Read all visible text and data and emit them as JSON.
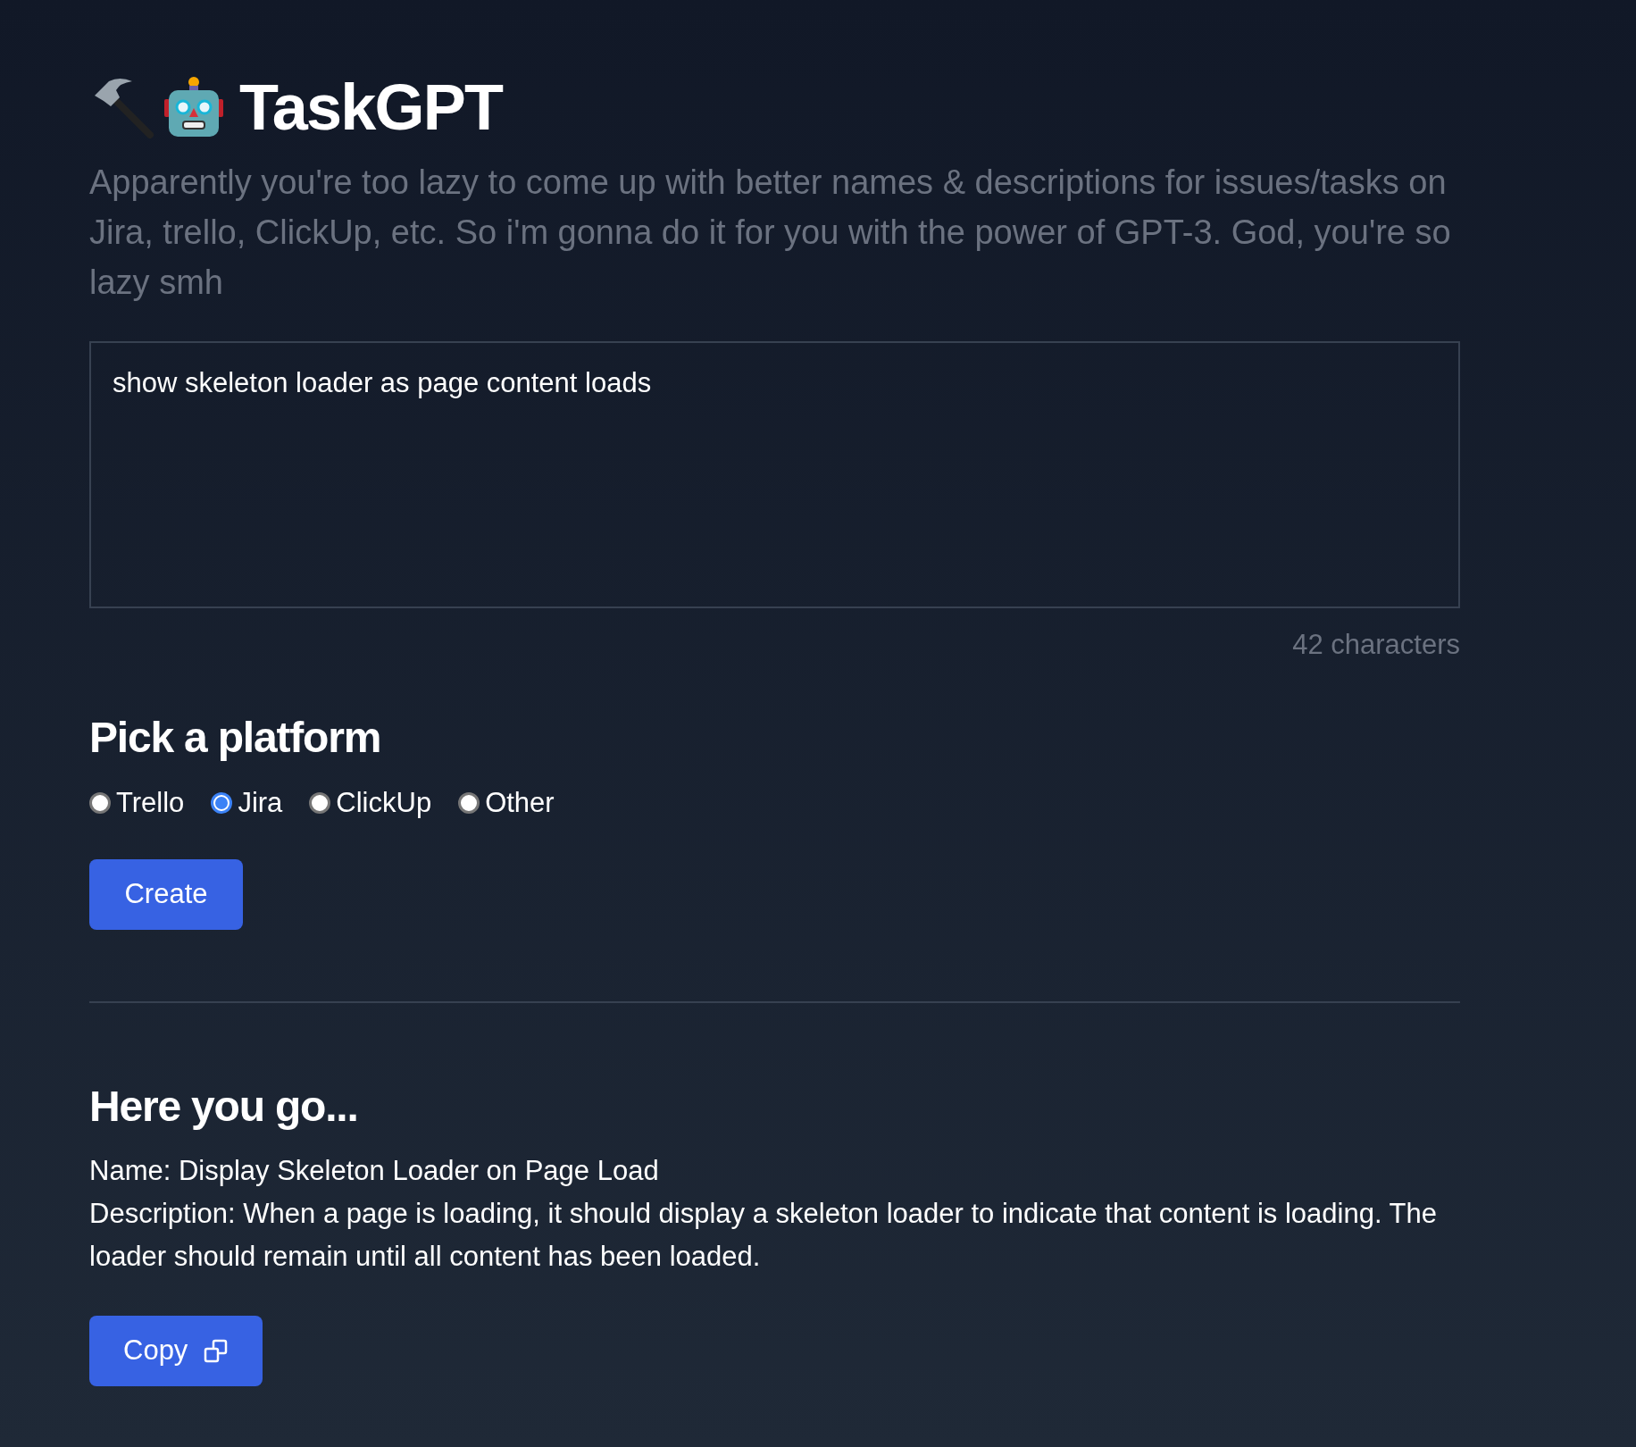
{
  "header": {
    "title": "TaskGPT",
    "subtitle": "Apparently you're too lazy to come up with better names & descriptions for issues/tasks on Jira, trello, ClickUp, etc. So i'm gonna do it for you with the power of GPT-3. God, you're so lazy smh"
  },
  "input": {
    "value": "show skeleton loader as page content loads",
    "counter": "42 characters"
  },
  "platform": {
    "heading": "Pick a platform",
    "options": [
      {
        "label": "Trello",
        "selected": false
      },
      {
        "label": "Jira",
        "selected": true
      },
      {
        "label": "ClickUp",
        "selected": false
      },
      {
        "label": "Other",
        "selected": false
      }
    ],
    "button": "Create"
  },
  "result": {
    "heading": "Here you go...",
    "lines": [
      "Name: Display Skeleton Loader on Page Load",
      "Description: When a page is loading, it should display a skeleton loader to indicate that content is loading. The loader should remain until all content has been loaded."
    ],
    "button": "Copy"
  }
}
